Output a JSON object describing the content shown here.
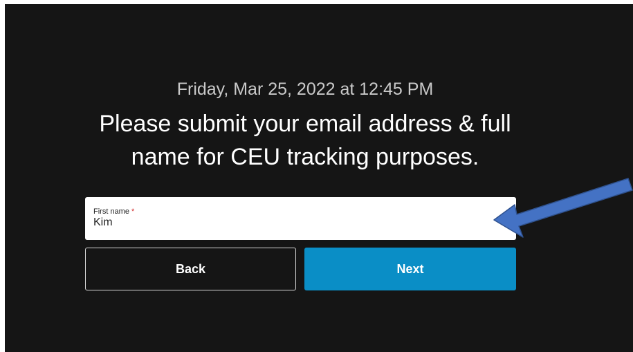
{
  "header": {
    "date_line": "Friday, Mar 25, 2022 at 12:45 PM",
    "heading_line1": "Please submit your email address & full",
    "heading_line2": "name for CEU tracking purposes."
  },
  "form": {
    "first_name": {
      "label": "First name",
      "required_marker": "*",
      "value": "Kim"
    }
  },
  "buttons": {
    "back_label": "Back",
    "next_label": "Next"
  },
  "colors": {
    "background": "#151515",
    "next_button": "#0a8ec6",
    "annotation_arrow": "#4472c4",
    "required_marker": "#d22d2d"
  },
  "annotation": {
    "icon": "arrow-pointer-icon"
  }
}
